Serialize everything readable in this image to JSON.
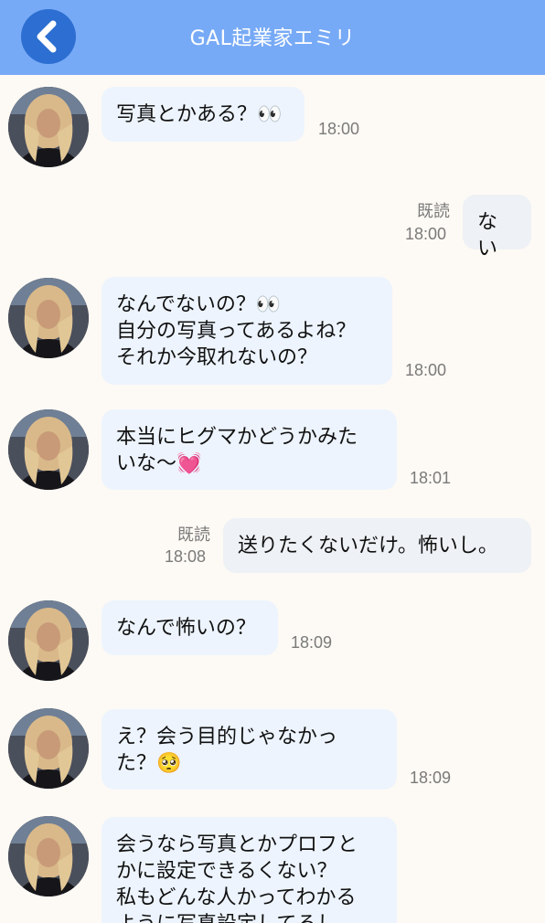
{
  "header": {
    "title": "GAL起業家エミリ"
  },
  "messages": [
    {
      "from": "partner",
      "text": "写真とかある？👀",
      "time": "18:00"
    },
    {
      "from": "me",
      "text": "ない",
      "time": "18:00",
      "read": "既読"
    },
    {
      "from": "partner",
      "text": "なんでないの？👀\n自分の写真ってあるよね？\nそれか今取れないの？",
      "time": "18:00"
    },
    {
      "from": "partner",
      "text": "本当にヒグマかどうかみた\nいな〜💓",
      "time": "18:01"
    },
    {
      "from": "me",
      "text": "送りたくないだけ。怖いし。",
      "time": "18:08",
      "read": "既読"
    },
    {
      "from": "partner",
      "text": "なんで怖いの？",
      "time": "18:09"
    },
    {
      "from": "partner",
      "text": "え？会う目的じゃなかっ\nた？🥺",
      "time": "18:09"
    },
    {
      "from": "partner",
      "text": "会うなら写真とかプロフと\nかに設定できるくない？\n私もどんな人かってわかる\nように写真設定してるし",
      "time": ""
    }
  ]
}
